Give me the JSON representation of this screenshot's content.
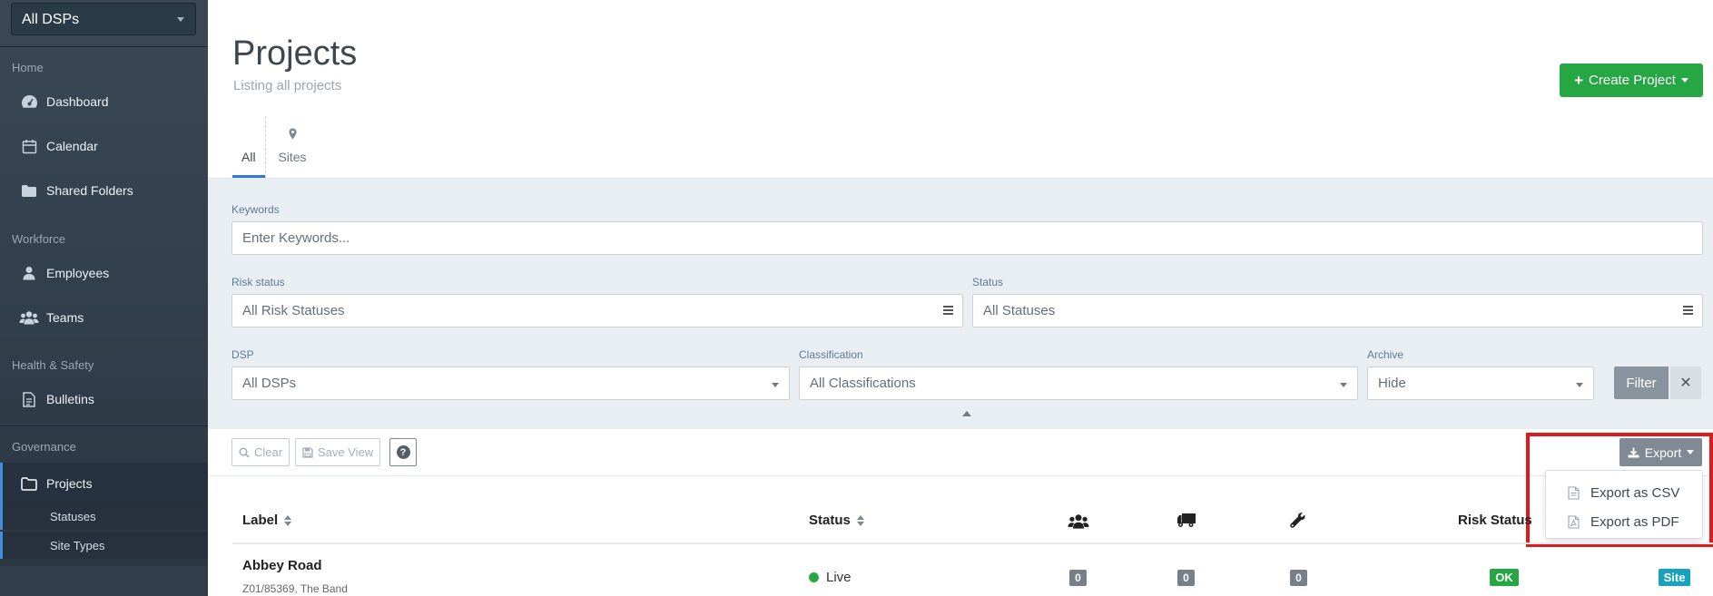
{
  "sidebar": {
    "dsp_select": "All DSPs",
    "sections": {
      "home": "Home",
      "workforce": "Workforce",
      "health_safety": "Health & Safety",
      "governance": "Governance"
    },
    "items": {
      "dashboard": "Dashboard",
      "calendar": "Calendar",
      "shared_folders": "Shared Folders",
      "employees": "Employees",
      "teams": "Teams",
      "bulletins": "Bulletins",
      "projects": "Projects",
      "statuses": "Statuses",
      "site_types": "Site Types"
    }
  },
  "header": {
    "title": "Projects",
    "subtitle": "Listing all projects",
    "create_label": "Create Project"
  },
  "tabs": {
    "all": "All",
    "sites": "Sites"
  },
  "filters": {
    "keywords_label": "Keywords",
    "keywords_placeholder": "Enter Keywords...",
    "risk_label": "Risk status",
    "risk_value": "All Risk Statuses",
    "status_label": "Status",
    "status_value": "All Statuses",
    "dsp_label": "DSP",
    "dsp_value": "All DSPs",
    "classification_label": "Classification",
    "classification_value": "All Classifications",
    "archive_label": "Archive",
    "archive_value": "Hide",
    "filter_button": "Filter"
  },
  "toolbar": {
    "clear": "Clear",
    "save_view": "Save View",
    "export": "Export",
    "export_menu": {
      "csv": "Export as CSV",
      "pdf": "Export as PDF"
    }
  },
  "table": {
    "headers": {
      "label": "Label",
      "status": "Status",
      "risk_status": "Risk Status"
    },
    "rows": [
      {
        "label": "Abbey Road",
        "sub": "Z01/85369, The Band",
        "status": "Live",
        "teams": "0",
        "vehicles": "0",
        "tools": "0",
        "risk": "OK",
        "type": "Site"
      }
    ]
  },
  "colors": {
    "sidebar_bg": "#333f4b",
    "primary_green": "#27a744",
    "accent_blue": "#2e7dd1",
    "site_teal": "#18a2bd",
    "highlight_red": "#e0191e"
  }
}
